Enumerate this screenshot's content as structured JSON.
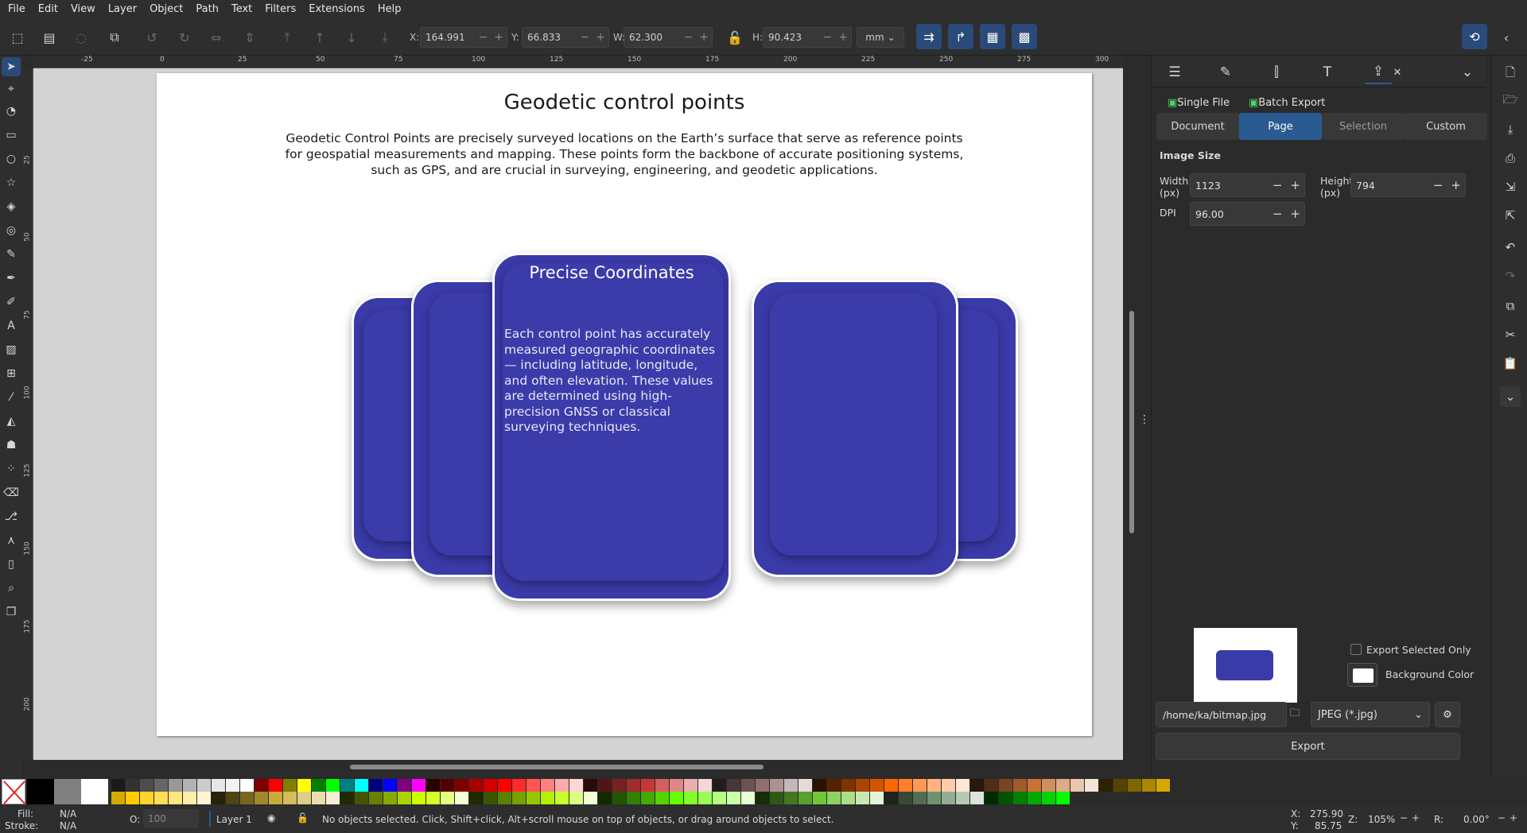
{
  "menu": [
    "File",
    "Edit",
    "View",
    "Layer",
    "Object",
    "Path",
    "Text",
    "Filters",
    "Extensions",
    "Help"
  ],
  "toolbar": {
    "x_label": "X:",
    "x_value": "164.991",
    "y_label": "Y:",
    "y_value": "66.833",
    "w_label": "W:",
    "w_value": "62.300",
    "h_label": "H:",
    "h_value": "90.423",
    "unit": "mm"
  },
  "ruler": {
    "h_ticks": [
      "-25",
      "0",
      "25",
      "50",
      "75",
      "100",
      "125",
      "150",
      "175",
      "200",
      "225",
      "250",
      "275",
      "300"
    ],
    "v_ticks": [
      "25",
      "50",
      "75",
      "100",
      "125",
      "150",
      "175",
      "200"
    ]
  },
  "document": {
    "title": "Geodetic control points",
    "description": "Geodetic Control Points are precisely surveyed locations on the Earth’s surface that serve as reference points for geospatial measurements and mapping. These points form the backbone of accurate positioning systems, such as GPS, and are crucial in surveying,   engineering, and geodetic applications.",
    "card_title": "Precise Coordinates",
    "card_body": "Each control point has accurately measured geographic coordinates — including latitude, longitude, and often elevation. These values are determined using high-precision GNSS or classical surveying techniques.",
    "card_color": "#3a3aa8"
  },
  "export_panel": {
    "single_file": "Single File",
    "batch_export": "Batch Export",
    "areas": [
      "Document",
      "Page",
      "Selection",
      "Custom"
    ],
    "selected_area": "Page",
    "image_size_label": "Image Size",
    "width_label": "Width\n(px)",
    "width_value": "1123",
    "height_label": "Height\n(px)",
    "height_value": "794",
    "dpi_label": "DPI",
    "dpi_value": "96.00",
    "export_selected_only": "Export Selected Only",
    "background_color": "Background Color",
    "filename": "/home/ka/bitmap.jpg",
    "format": "JPEG (*.jpg)",
    "export_button": "Export"
  },
  "status": {
    "fill_label": "Fill:",
    "fill_value": "N/A",
    "stroke_label": "Stroke:",
    "stroke_value": "N/A",
    "opacity_label": "O:",
    "opacity_value": "100",
    "layer": "Layer 1",
    "message": "No objects selected. Click, Shift+click, Alt+scroll mouse on top of objects, or drag around objects to select.",
    "x_label": "X:",
    "x_value": "275.90",
    "y_label": "Y:",
    "y_value": "85.75",
    "zoom_label": "Z:",
    "zoom_value": "105%",
    "rotation_label": "R:",
    "rotation_value": "0.00°"
  },
  "accent_color": "#2a5a92"
}
